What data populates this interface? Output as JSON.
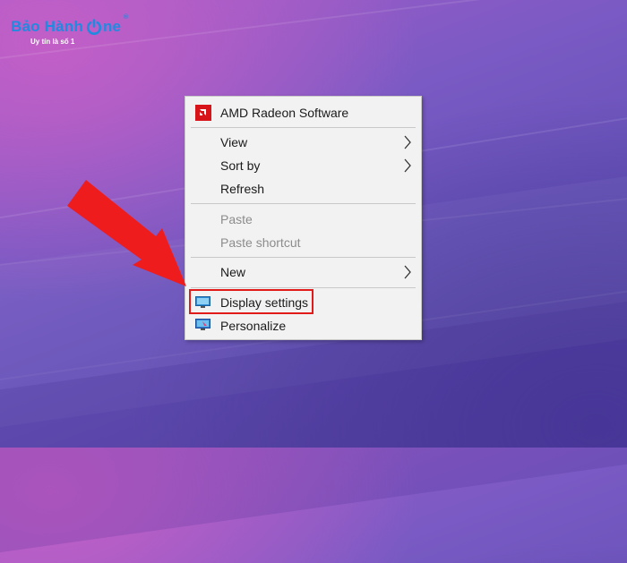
{
  "logo": {
    "text_left": "Bảo Hành",
    "text_right": "ne",
    "tagline": "Uy tín là số 1",
    "reg": "®"
  },
  "menu": {
    "amd": "AMD Radeon Software",
    "view": "View",
    "sort_by": "Sort by",
    "refresh": "Refresh",
    "paste": "Paste",
    "paste_shortcut": "Paste shortcut",
    "new": "New",
    "display_settings": "Display settings",
    "personalize": "Personalize"
  },
  "colors": {
    "highlight_box": "#e11a1a",
    "arrow": "#ee1c1c",
    "amd_icon": "#d7141a",
    "logo_blue": "#1e8be0"
  },
  "icons": {
    "amd": "amd-radeon-icon",
    "display": "display-settings-icon",
    "personalize": "personalize-icon",
    "submenu": "chevron-right-icon"
  }
}
